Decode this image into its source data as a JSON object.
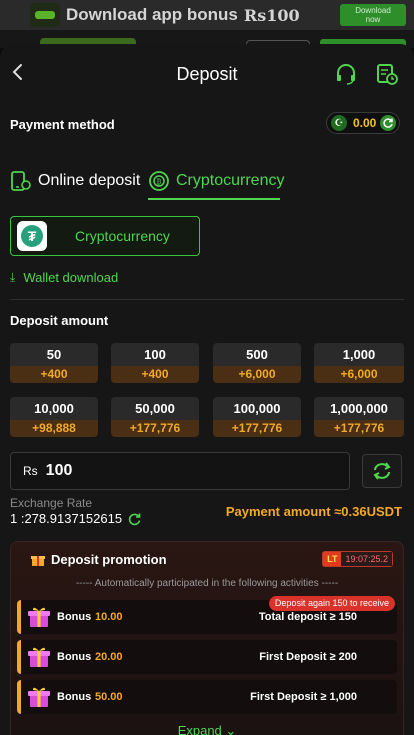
{
  "banner": {
    "text": "Download app bonus",
    "amount": "Rs100",
    "button_label_line1": "Download",
    "button_label_line2": "now"
  },
  "header": {
    "title": "Deposit"
  },
  "payment": {
    "label": "Payment method",
    "balance": "0.00",
    "flag_icon": "crescent-star-icon"
  },
  "tabs": [
    {
      "label": "Online deposit",
      "active": false
    },
    {
      "label": "Cryptocurrency",
      "active": true
    }
  ],
  "crypto": {
    "card_label": "Cryptocurrency",
    "wallet_label": "Wallet download"
  },
  "deposit": {
    "label": "Deposit amount",
    "options": [
      {
        "amount": "50",
        "bonus": "+400"
      },
      {
        "amount": "100",
        "bonus": "+400"
      },
      {
        "amount": "500",
        "bonus": "+6,000"
      },
      {
        "amount": "1,000",
        "bonus": "+6,000"
      },
      {
        "amount": "10,000",
        "bonus": "+98,888"
      },
      {
        "amount": "50,000",
        "bonus": "+177,776"
      },
      {
        "amount": "100,000",
        "bonus": "+177,776"
      },
      {
        "amount": "1,000,000",
        "bonus": "+177,776"
      }
    ],
    "currency": "Rs",
    "input_value": "100"
  },
  "exchange": {
    "label": "Exchange Rate",
    "value": "1 :278.9137152615",
    "payment_amount": "Payment amount ≈0.36USDT"
  },
  "promotion": {
    "title": "Deposit promotion",
    "lt_badge": "LT",
    "timer": "19:07:25.2",
    "note": "----- Automatically participated in the following activities -----",
    "again_badge": "Deposit again 150 to receive",
    "rows": [
      {
        "label": "Bonus",
        "value": "10.00",
        "condition": "Total deposit ≥ 150"
      },
      {
        "label": "Bonus",
        "value": "20.00",
        "condition": "First Deposit ≥ 200"
      },
      {
        "label": "Bonus",
        "value": "50.00",
        "condition": "First Deposit ≥ 1,000"
      }
    ],
    "expand_label": "Expand"
  },
  "colors": {
    "accent_green": "#4fd64f",
    "bonus_orange": "#f2a928",
    "background": "#161616"
  }
}
